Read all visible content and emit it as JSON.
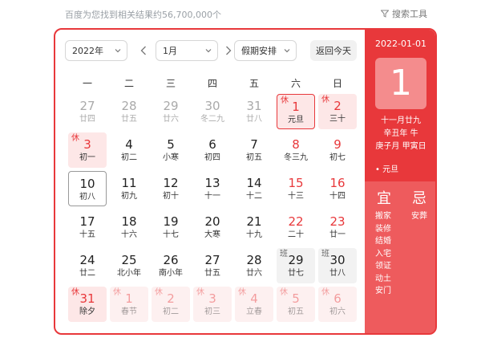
{
  "header": {
    "result_count": "百度为您找到相关结果约56,700,000个",
    "search_tools": "搜索工具"
  },
  "controls": {
    "year": "2022年",
    "month": "1月",
    "holiday": "假期安排",
    "today": "返回今天"
  },
  "weekdays": [
    "一",
    "二",
    "三",
    "四",
    "五",
    "六",
    "日"
  ],
  "days": [
    {
      "num": "27",
      "lunar": "廿四",
      "tag": "",
      "cls": "other"
    },
    {
      "num": "28",
      "lunar": "廿五",
      "tag": "",
      "cls": "other"
    },
    {
      "num": "29",
      "lunar": "廿六",
      "tag": "",
      "cls": "other"
    },
    {
      "num": "30",
      "lunar": "冬二九",
      "tag": "",
      "cls": "other"
    },
    {
      "num": "31",
      "lunar": "廿八",
      "tag": "",
      "cls": "other"
    },
    {
      "num": "1",
      "lunar": "元旦",
      "tag": "休",
      "cls": "holiday selected"
    },
    {
      "num": "2",
      "lunar": "三十",
      "tag": "休",
      "cls": "holiday"
    },
    {
      "num": "3",
      "lunar": "初一",
      "tag": "休",
      "cls": "holiday"
    },
    {
      "num": "4",
      "lunar": "初二",
      "tag": "",
      "cls": ""
    },
    {
      "num": "5",
      "lunar": "小寒",
      "tag": "",
      "cls": ""
    },
    {
      "num": "6",
      "lunar": "初四",
      "tag": "",
      "cls": ""
    },
    {
      "num": "7",
      "lunar": "初五",
      "tag": "",
      "cls": ""
    },
    {
      "num": "8",
      "lunar": "冬三九",
      "tag": "",
      "cls": "weekend"
    },
    {
      "num": "9",
      "lunar": "初七",
      "tag": "",
      "cls": "weekend"
    },
    {
      "num": "10",
      "lunar": "初八",
      "tag": "",
      "cls": "today"
    },
    {
      "num": "11",
      "lunar": "初九",
      "tag": "",
      "cls": ""
    },
    {
      "num": "12",
      "lunar": "初十",
      "tag": "",
      "cls": ""
    },
    {
      "num": "13",
      "lunar": "十一",
      "tag": "",
      "cls": ""
    },
    {
      "num": "14",
      "lunar": "十二",
      "tag": "",
      "cls": ""
    },
    {
      "num": "15",
      "lunar": "十三",
      "tag": "",
      "cls": "weekend"
    },
    {
      "num": "16",
      "lunar": "十四",
      "tag": "",
      "cls": "weekend"
    },
    {
      "num": "17",
      "lunar": "十五",
      "tag": "",
      "cls": ""
    },
    {
      "num": "18",
      "lunar": "十六",
      "tag": "",
      "cls": ""
    },
    {
      "num": "19",
      "lunar": "十七",
      "tag": "",
      "cls": ""
    },
    {
      "num": "20",
      "lunar": "大寒",
      "tag": "",
      "cls": ""
    },
    {
      "num": "21",
      "lunar": "十九",
      "tag": "",
      "cls": ""
    },
    {
      "num": "22",
      "lunar": "二十",
      "tag": "",
      "cls": "weekend"
    },
    {
      "num": "23",
      "lunar": "廿一",
      "tag": "",
      "cls": "weekend"
    },
    {
      "num": "24",
      "lunar": "廿二",
      "tag": "",
      "cls": ""
    },
    {
      "num": "25",
      "lunar": "北小年",
      "tag": "",
      "cls": ""
    },
    {
      "num": "26",
      "lunar": "南小年",
      "tag": "",
      "cls": ""
    },
    {
      "num": "27",
      "lunar": "廿五",
      "tag": "",
      "cls": ""
    },
    {
      "num": "28",
      "lunar": "廿六",
      "tag": "",
      "cls": ""
    },
    {
      "num": "29",
      "lunar": "廿七",
      "tag": "班",
      "cls": "work"
    },
    {
      "num": "30",
      "lunar": "廿八",
      "tag": "班",
      "cls": "work"
    },
    {
      "num": "31",
      "lunar": "除夕",
      "tag": "休",
      "cls": "holiday"
    },
    {
      "num": "1",
      "lunar": "春节",
      "tag": "休",
      "cls": "holiday faded"
    },
    {
      "num": "2",
      "lunar": "初二",
      "tag": "休",
      "cls": "holiday faded"
    },
    {
      "num": "3",
      "lunar": "初三",
      "tag": "休",
      "cls": "holiday faded"
    },
    {
      "num": "4",
      "lunar": "立春",
      "tag": "休",
      "cls": "holiday faded"
    },
    {
      "num": "5",
      "lunar": "初五",
      "tag": "休",
      "cls": "holiday faded"
    },
    {
      "num": "6",
      "lunar": "初六",
      "tag": "休",
      "cls": "holiday faded"
    }
  ],
  "side": {
    "date": "2022-01-01",
    "day": "1",
    "lunar_lines": [
      "十一月廿九",
      "辛丑年 牛",
      "庚子月 甲寅日"
    ],
    "festival": "• 元旦",
    "yi_title": "宜",
    "ji_title": "忌",
    "yi_items": [
      "搬家",
      "装修",
      "结婚",
      "入宅",
      "领证",
      "动土",
      "安门"
    ],
    "ji_items": [
      "安葬"
    ]
  },
  "colors": {
    "accent": "#e8383b",
    "holiday_bg": "#fde7e7",
    "work_bg": "#f2f2f2"
  }
}
